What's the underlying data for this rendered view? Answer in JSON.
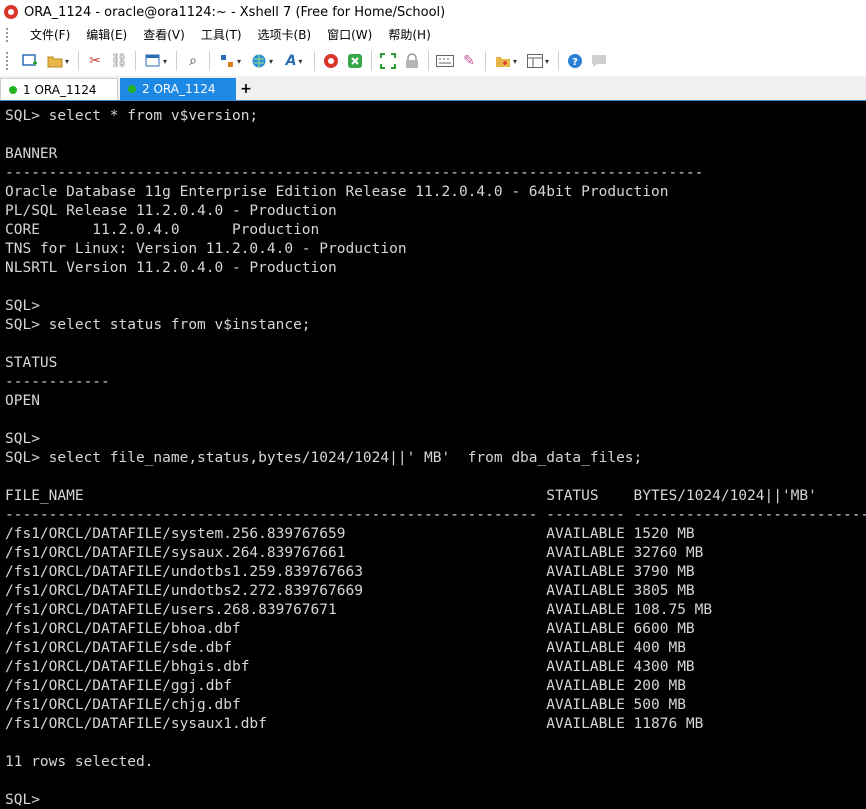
{
  "window": {
    "title": "ORA_1124 - oracle@ora1124:~ - Xshell 7 (Free for Home/School)"
  },
  "menu": [
    "文件(F)",
    "编辑(E)",
    "查看(V)",
    "工具(T)",
    "选项卡(B)",
    "窗口(W)",
    "帮助(H)"
  ],
  "tabs": [
    {
      "label": "1 ORA_1124",
      "active": false
    },
    {
      "label": "2 ORA_1124",
      "active": true
    }
  ],
  "tab_add_label": "+",
  "colors": {
    "accent": "#1e88e5",
    "connected_dot": "#21b321",
    "terminal_bg": "#000000",
    "terminal_fg": "#d6d6d6"
  },
  "terminal": {
    "lines": [
      "SQL> select * from v$version;",
      "",
      "BANNER",
      "--------------------------------------------------------------------------------",
      "Oracle Database 11g Enterprise Edition Release 11.2.0.4.0 - 64bit Production",
      "PL/SQL Release 11.2.0.4.0 - Production",
      "CORE\t11.2.0.4.0\tProduction",
      "TNS for Linux: Version 11.2.0.4.0 - Production",
      "NLSRTL Version 11.2.0.4.0 - Production",
      "",
      "SQL>",
      "SQL> select status from v$instance;",
      "",
      "STATUS",
      "------------",
      "OPEN",
      "",
      "SQL>",
      "SQL> select file_name,status,bytes/1024/1024||' MB'  from dba_data_files;",
      "",
      "FILE_NAME                                                     STATUS    BYTES/1024/1024||'MB'",
      "------------------------------------------------------------- --------- ------------------------------",
      "/fs1/ORCL/DATAFILE/system.256.839767659                       AVAILABLE 1520 MB",
      "/fs1/ORCL/DATAFILE/sysaux.264.839767661                       AVAILABLE 32760 MB",
      "/fs1/ORCL/DATAFILE/undotbs1.259.839767663                     AVAILABLE 3790 MB",
      "/fs1/ORCL/DATAFILE/undotbs2.272.839767669                     AVAILABLE 3805 MB",
      "/fs1/ORCL/DATAFILE/users.268.839767671                        AVAILABLE 108.75 MB",
      "/fs1/ORCL/DATAFILE/bhoa.dbf                                   AVAILABLE 6600 MB",
      "/fs1/ORCL/DATAFILE/sde.dbf                                    AVAILABLE 400 MB",
      "/fs1/ORCL/DATAFILE/bhgis.dbf                                  AVAILABLE 4300 MB",
      "/fs1/ORCL/DATAFILE/ggj.dbf                                    AVAILABLE 200 MB",
      "/fs1/ORCL/DATAFILE/chjg.dbf                                   AVAILABLE 500 MB",
      "/fs1/ORCL/DATAFILE/sysaux1.dbf                                AVAILABLE 11876 MB",
      "",
      "11 rows selected.",
      "",
      "SQL>"
    ]
  }
}
